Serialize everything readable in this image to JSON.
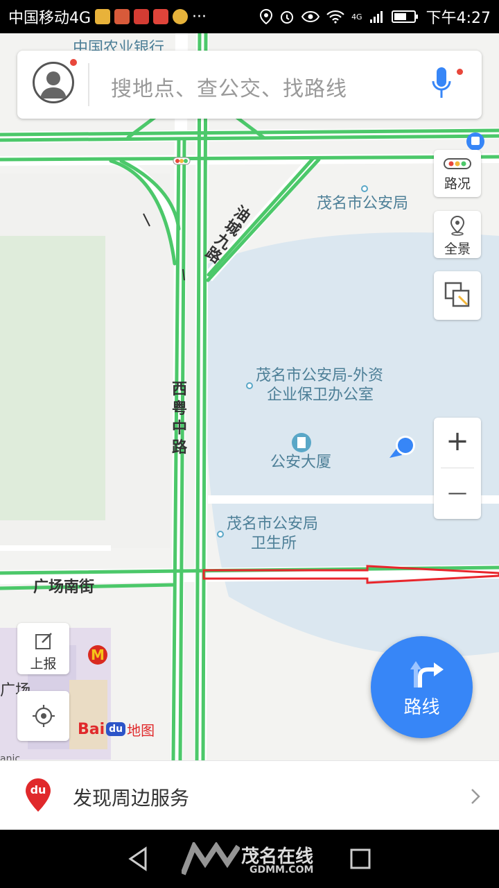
{
  "status_bar": {
    "carrier": "中国移动4G",
    "more": "···",
    "network": "4G",
    "time": "下午4:27"
  },
  "search": {
    "placeholder": "搜地点、查公交、找路线"
  },
  "controls": {
    "traffic_label": "路况",
    "panorama_label": "全景",
    "zoom_in_label": "+",
    "zoom_out_label": "—",
    "report_label": "上报"
  },
  "map": {
    "labels": {
      "bank": "中国农业银行",
      "police_bureau": "茂名市公安局",
      "foreign_office_line1": "茂名市公安局-外资",
      "foreign_office_line2": "企业保卫办公室",
      "public_security_building": "公安大厦",
      "clinic_line1": "茂名市公安局",
      "clinic_line2": "卫生所",
      "plaza_partial": "广场",
      "mall_partial": "anic"
    },
    "roads": {
      "xiyue_zhong": "西粤中路",
      "youcheng_jiu": "油城九路",
      "guangchang_nan": "广场南街"
    },
    "logo": {
      "mcdonalds": "M",
      "baidu_text": "Bai",
      "baidu_du": "du",
      "baidu_map": "地图"
    },
    "colors": {
      "road_traffic": "#4cc86a",
      "route_arrow": "#e8262c",
      "accent": "#3786f7",
      "park": "#cfe8c8",
      "highlight_area": "#dbe7f0"
    }
  },
  "route_button": {
    "label": "路线"
  },
  "bottom_panel": {
    "icon_text": "du",
    "text": "发现周边服务"
  },
  "nav_bar": {
    "watermark_line1": "茂名在线",
    "watermark_line2": "GDMM.COM"
  }
}
